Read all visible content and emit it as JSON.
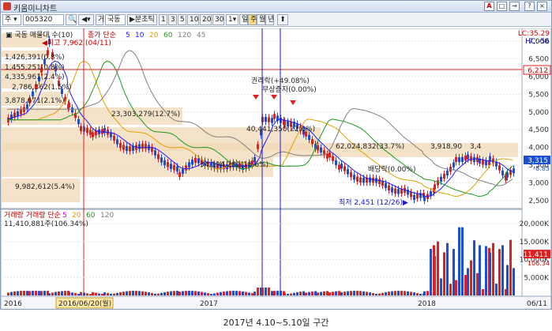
{
  "window": {
    "title": "키움미니차트",
    "title_buttons": [
      "A",
      "□",
      "→",
      "?",
      "×"
    ]
  },
  "toolbar": {
    "market": "주",
    "code": "005320",
    "stock_name": "국동",
    "split": "분초틱",
    "periods": [
      "1",
      "3",
      "5",
      "10",
      "20",
      "30"
    ],
    "period_count": "1",
    "frames": [
      "일",
      "주",
      "월",
      "년"
    ],
    "selected_frame": "주"
  },
  "price_panel": {
    "legend_title": "국동 매물대 수(10)",
    "legend_ma": "종가 단순",
    "ma_periods": [
      {
        "label": "5",
        "color": "#1a1aff"
      },
      {
        "label": "10",
        "color": "#1a1aff"
      },
      {
        "label": "20",
        "color": "#e0a000"
      },
      {
        "label": "60",
        "color": "#1a9a1a"
      },
      {
        "label": "120",
        "color": "#808080"
      },
      {
        "label": "45",
        "color": "#808080"
      }
    ],
    "y_ticks": [
      "7,000",
      "6,500",
      "6,000",
      "5,500",
      "5,000",
      "4,500",
      "4,000",
      "3,500",
      "3,000",
      "2,500"
    ],
    "top_right": "LC:35.29",
    "hc": "HC:-56",
    "ref_price": "6,212",
    "current_price": "3,315",
    "current_diff": "-8.83",
    "annotations": {
      "high": "최고 7,962 (04/11)",
      "low": "최저 2,451 (12/26)",
      "event1": "권리락(+49.08%)",
      "event2": "무상증자(0.00%)",
      "event3": "배당락(0.00%)"
    },
    "volume_profile": [
      "1,426,391(0.8%)",
      "1,455,251(0.8%)",
      "4,335,961(2.4%)",
      "2,786,362(1.5%)",
      "3,878,671(2.1%)",
      "23,303,279(12.7%)",
      "40,441,350(22.6%)",
      "62,024,832(33.7%)",
      "3,918,90",
      "3,4",
      "34,194,282(18.6%)",
      "9,982,612(5.4%)"
    ]
  },
  "volume_panel": {
    "legend": "거래량 단순",
    "ma_periods": [
      {
        "label": "5",
        "color": "#c000c0"
      },
      {
        "label": "20",
        "color": "#e0a000"
      },
      {
        "label": "60",
        "color": "#1a9a1a"
      },
      {
        "label": "120",
        "color": "#808080"
      }
    ],
    "readout": "11,410,881주(106.34%)",
    "y_ticks": [
      "20,000K",
      "15,000K",
      "10,000K",
      "5,000K"
    ],
    "current_value": "11,411",
    "current_pct": "106.34"
  },
  "x_axis": {
    "labels": [
      "2016",
      "2017",
      "2018",
      "06/11"
    ],
    "cursor_date": "2016/06/20(월)"
  },
  "caption": "2017년 4.10~5.10일 구간"
}
